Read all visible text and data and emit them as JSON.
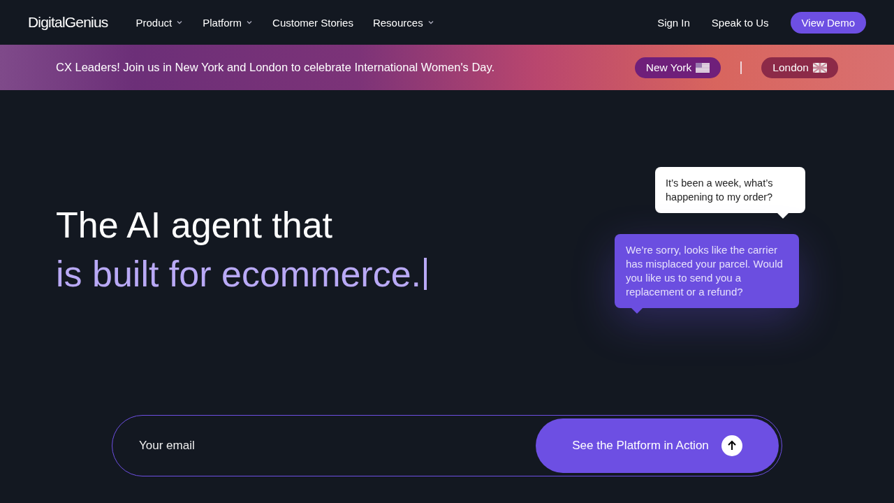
{
  "nav": {
    "logo": "DigitalGenius",
    "links": [
      {
        "label": "Product",
        "dropdown": true
      },
      {
        "label": "Platform",
        "dropdown": true
      },
      {
        "label": "Customer Stories",
        "dropdown": false
      },
      {
        "label": "Resources",
        "dropdown": true
      }
    ],
    "actions": [
      {
        "label": "Sign In",
        "kind": "link"
      },
      {
        "label": "Speak to Us",
        "kind": "link"
      },
      {
        "label": "View Demo",
        "kind": "button"
      }
    ]
  },
  "banner": {
    "text": "CX Leaders! Join us in New York and London to celebrate International Women's Day.",
    "events": [
      {
        "label": "New York",
        "kind": "us"
      },
      {
        "label": "London",
        "kind": "uk"
      }
    ]
  },
  "hero": {
    "title_line_1": "The AI agent that",
    "title_line_2": "is built for ecommerce."
  },
  "chat": [
    {
      "text": "It’s been a week, what’s happening to my order?",
      "kind": "customer"
    },
    {
      "text": "We’re sorry, looks like the carrier has misplaced your parcel. Would you like us to send you a replacement or a refund?",
      "kind": "agent"
    }
  ],
  "signup": {
    "placeholder": "Your email",
    "button": "See the Platform in Action"
  }
}
